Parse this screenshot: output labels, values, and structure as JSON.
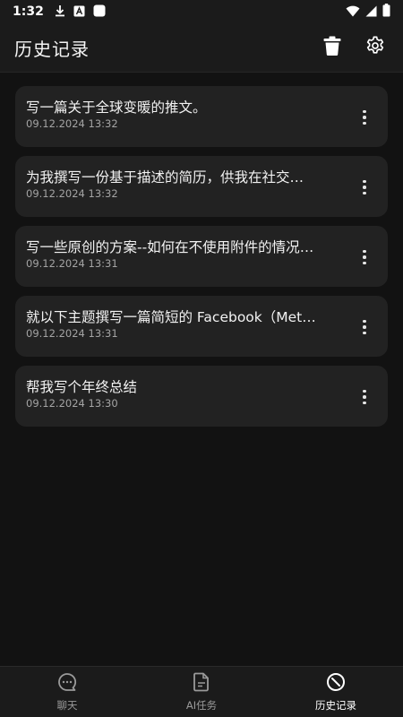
{
  "status_bar": {
    "time": "1:32",
    "icons": [
      "download-icon",
      "app-a-icon",
      "app-square-icon",
      "wifi-icon",
      "signal-icon",
      "battery-icon"
    ]
  },
  "app_bar": {
    "title": "历史记录",
    "actions": [
      "trash-icon",
      "gear-icon"
    ]
  },
  "history": [
    {
      "title": "写一篇关于全球变暖的推文。",
      "date": "09.12.2024 13:32"
    },
    {
      "title": "为我撰写一份基于描述的简历，供我在社交…",
      "date": "09.12.2024 13:32"
    },
    {
      "title": "写一些原创的方案--如何在不使用附件的情况…",
      "date": "09.12.2024 13:31"
    },
    {
      "title": "就以下主题撰写一篇简短的 Facebook（Met…",
      "date": "09.12.2024 13:31"
    },
    {
      "title": "帮我写个年终总结",
      "date": "09.12.2024 13:30"
    }
  ],
  "bottom_nav": {
    "items": [
      {
        "label": "聊天",
        "icon": "chat-icon",
        "active": false
      },
      {
        "label": "AI任务",
        "icon": "document-icon",
        "active": false
      },
      {
        "label": "历史记录",
        "icon": "history-icon",
        "active": true
      }
    ]
  },
  "colors": {
    "background": "#121212",
    "bar": "#1b1b1b",
    "card": "#222222",
    "text": "#f2f2f2",
    "subtext": "#a4a4a4",
    "nav_inactive": "#9a9a9a"
  }
}
